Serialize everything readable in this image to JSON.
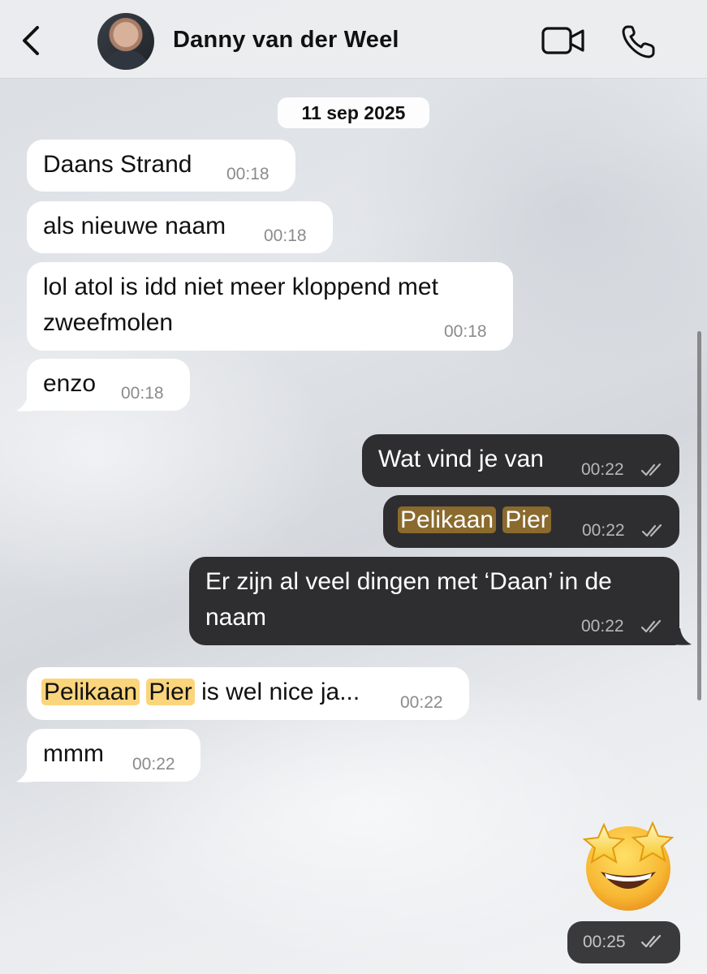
{
  "header": {
    "contact_name": "Danny van der Weel",
    "back_icon": "chevron-left-icon",
    "video_icon": "video-camera-icon",
    "call_icon": "phone-icon"
  },
  "date_separator": "11 sep 2025",
  "messages": [
    {
      "direction": "in",
      "text": "Daans Strand",
      "time": "00:18"
    },
    {
      "direction": "in",
      "text": "als nieuwe naam",
      "time": "00:18"
    },
    {
      "direction": "in",
      "text": "lol atol is idd niet meer kloppend met zweefmolen",
      "time": "00:18"
    },
    {
      "direction": "in",
      "text": "enzo",
      "time": "00:18"
    },
    {
      "direction": "out",
      "text": "Wat vind je van",
      "time": "00:22",
      "status": "read"
    },
    {
      "direction": "out",
      "text_parts": [
        "Pelikaan",
        "Pier"
      ],
      "time": "00:22",
      "status": "read"
    },
    {
      "direction": "out",
      "text": "Er zijn al veel dingen met ‘Daan’ in de naam",
      "time": "00:22",
      "status": "read"
    },
    {
      "direction": "in",
      "text_parts": [
        "Pelikaan",
        "Pier",
        "is wel nice ja..."
      ],
      "time": "00:22"
    },
    {
      "direction": "in",
      "text": "mmm",
      "time": "00:22"
    },
    {
      "direction": "out",
      "emoji": "star-struck-emoji",
      "time": "00:25",
      "status": "read"
    }
  ],
  "colors": {
    "incoming_bubble": "#ffffff",
    "outgoing_bubble": "#2e2e30",
    "highlight_outgoing": "#8a6a2d",
    "highlight_incoming": "#fbd57c"
  }
}
